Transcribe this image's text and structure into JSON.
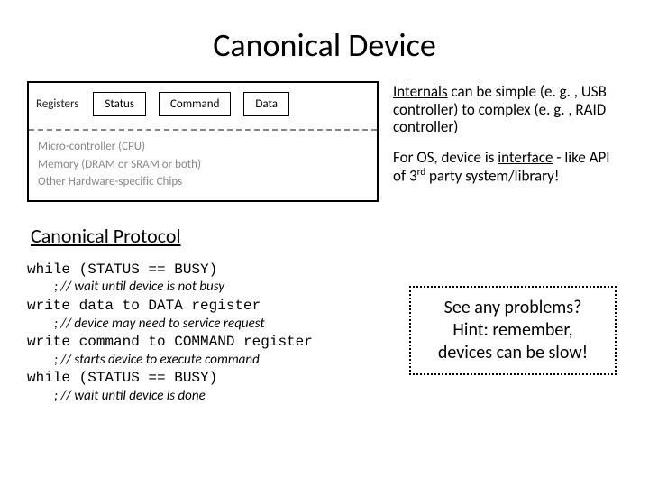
{
  "title": "Canonical Device",
  "diagram": {
    "registers_label": "Registers",
    "boxes": [
      "Status",
      "Command",
      "Data"
    ],
    "internals": [
      "Micro-controller (CPU)",
      "Memory (DRAM or SRAM or both)",
      "Other Hardware-specific Chips"
    ]
  },
  "notes": {
    "p1_a": "Internals",
    "p1_b": " can be simple (e. g. , USB controller) to complex (e. g. , RAID controller)",
    "p2_a": "For OS, device is ",
    "p2_b": "interface",
    "p2_c": " - like API of 3",
    "p2_d": "rd",
    "p2_e": " party system/library!"
  },
  "protocol_heading": "Canonical Protocol",
  "code": {
    "l1": "while (STATUS == BUSY)",
    "c1": "; // wait until device is not busy",
    "l2": "write data to DATA register",
    "c2": "; // device may need to service request",
    "l3": "write command to COMMAND register",
    "c3": "; // starts device to execute command",
    "l4": "while (STATUS == BUSY)",
    "c4": "; // wait until device is done"
  },
  "callout": {
    "line1": "See any problems?",
    "line2": "Hint: remember,",
    "line3": "devices can be slow!"
  }
}
